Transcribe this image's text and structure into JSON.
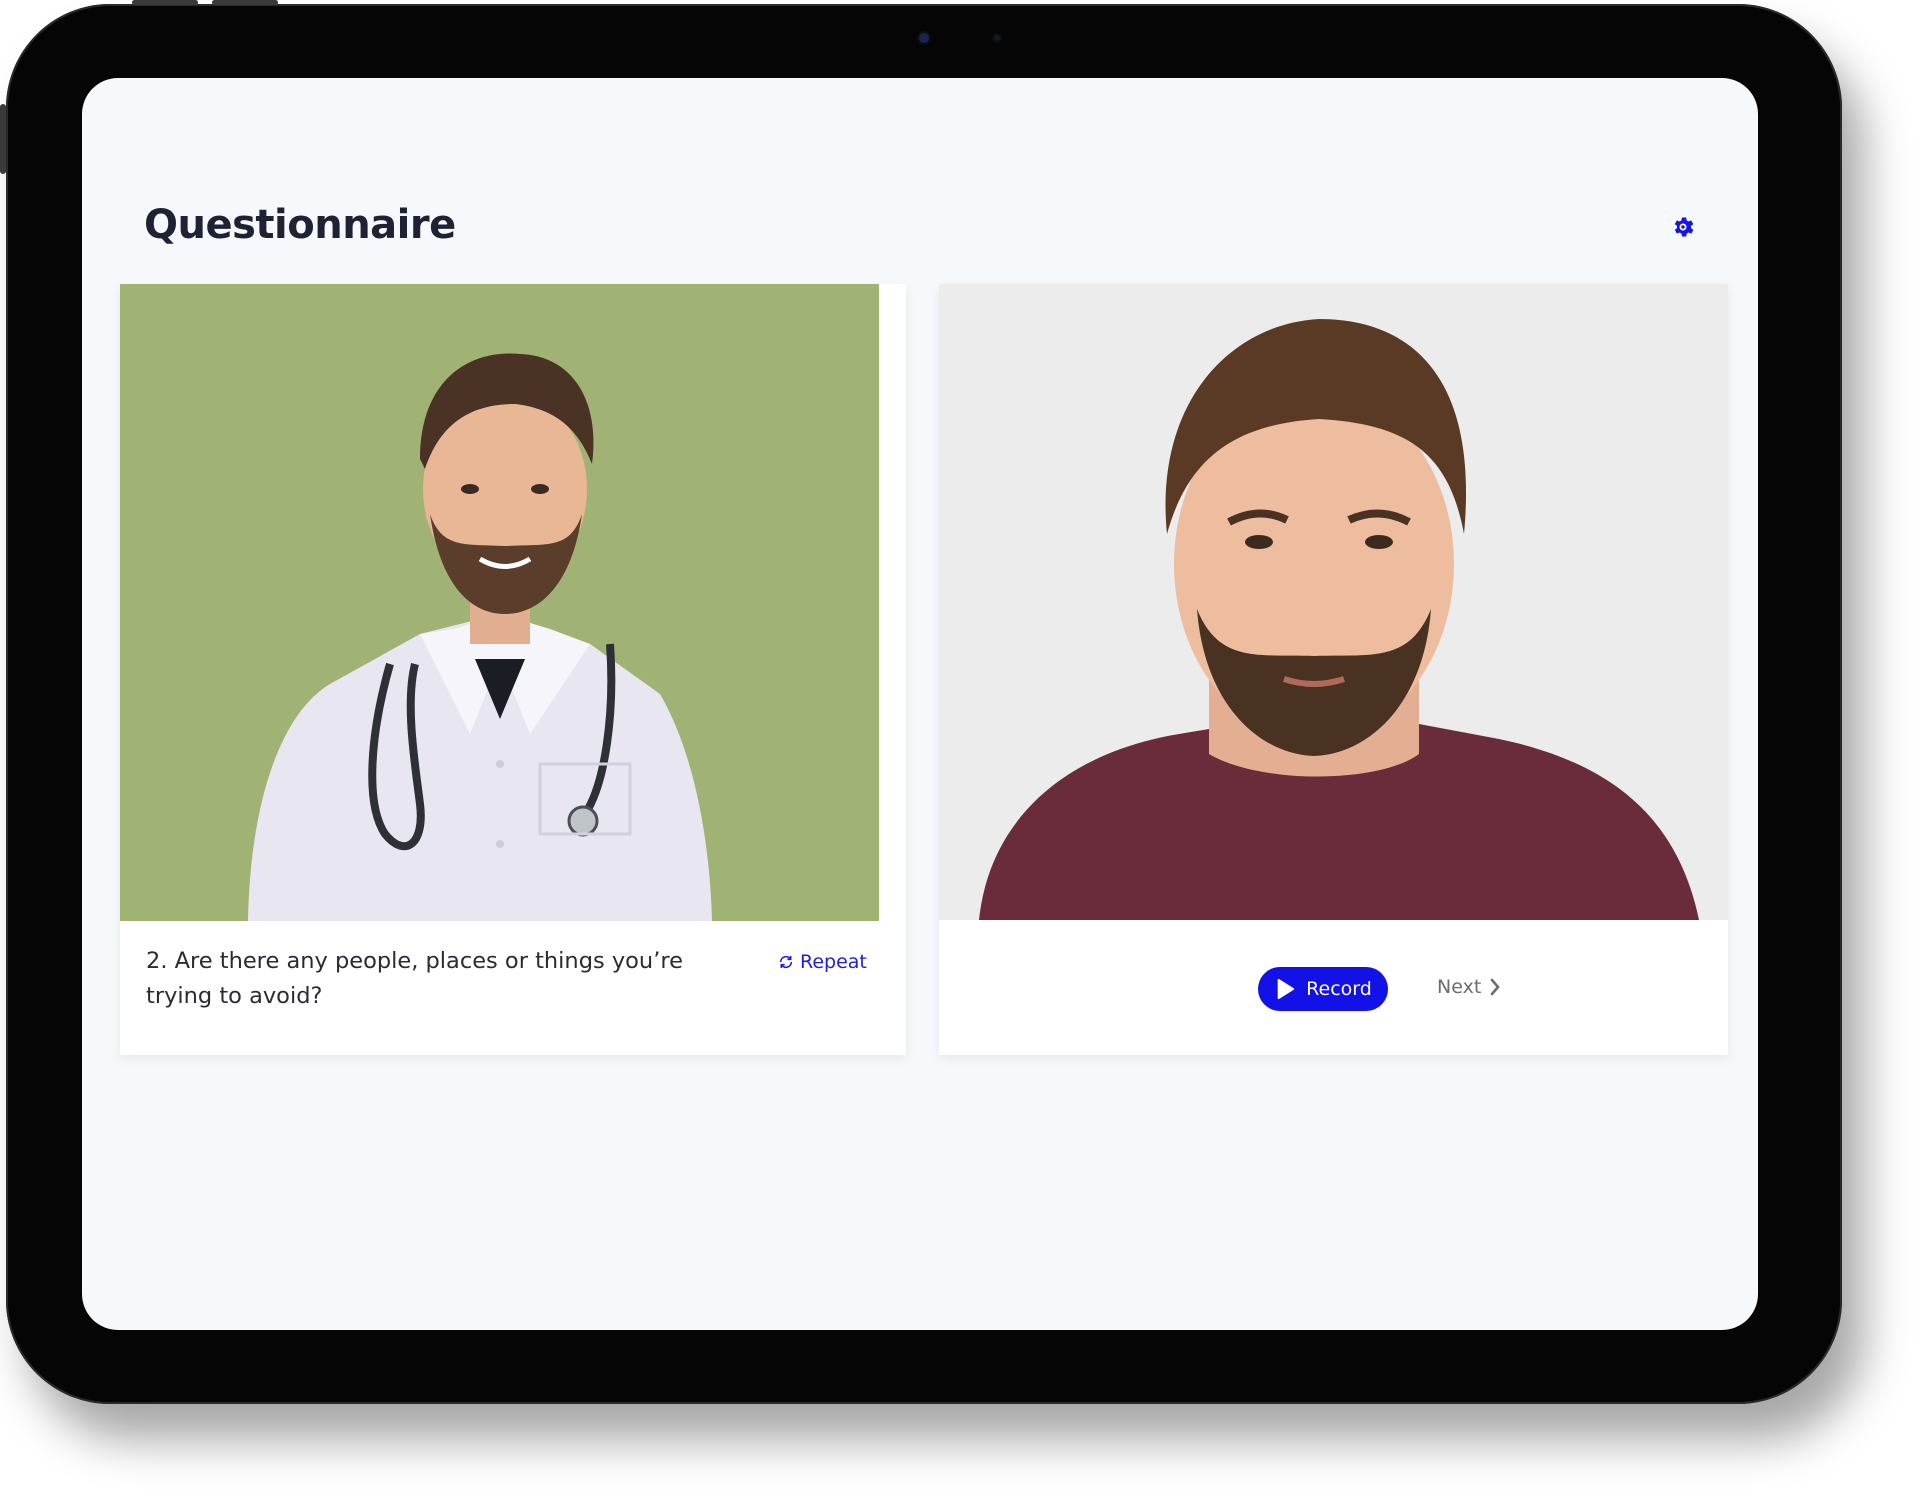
{
  "app": {
    "title": "Questionnaire"
  },
  "header": {
    "settings_icon": "gear-icon"
  },
  "interviewer": {
    "photo": "doctor-portrait",
    "question": "2. Are there any people, places or things you’re trying to avoid?",
    "repeat_label": "Repeat",
    "repeat_icon": "refresh-icon"
  },
  "participant": {
    "photo": "participant-portrait",
    "record_label": "Record",
    "record_icon": "play-icon",
    "next_label": "Next",
    "next_icon": "chevron-right-icon"
  },
  "colors": {
    "accent": "#1111e8",
    "link": "#1d1ddf",
    "background": "#f6f9fc",
    "title": "#1e2233",
    "muted": "#6c6c74"
  }
}
